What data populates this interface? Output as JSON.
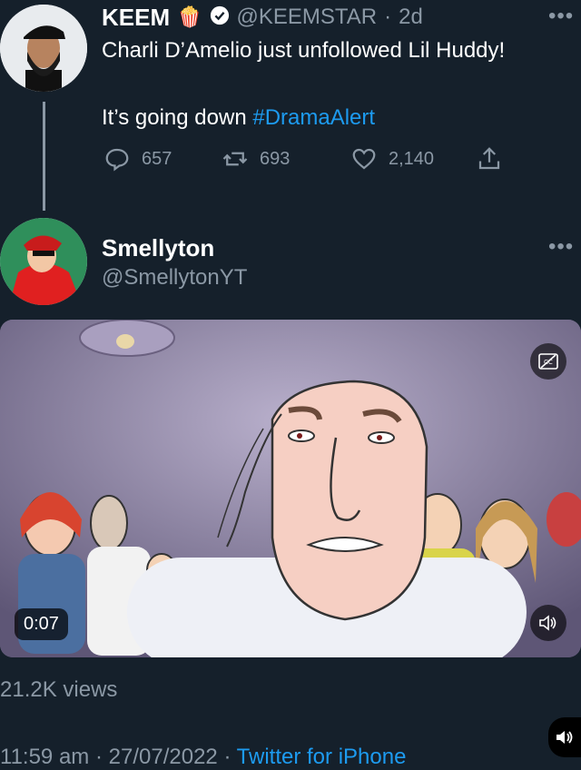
{
  "original_tweet": {
    "display_name": "KEEM",
    "emoji": "🍿",
    "handle": "@KEEMSTAR",
    "age": "2d",
    "text_line1": "Charli D’Amelio just unfollowed Lil Huddy!",
    "text_line2_prefix": "It’s going down ",
    "hashtag": "#DramaAlert",
    "replies": "657",
    "retweets": "693",
    "likes": "2,140"
  },
  "reply_tweet": {
    "display_name": "Smellyton",
    "handle": "@SmellytonYT"
  },
  "video": {
    "timestamp": "0:07"
  },
  "stats": {
    "views": "21.2K views"
  },
  "footer": {
    "time": "11:59 am",
    "date": "27/07/2022",
    "separator": "·",
    "source": "Twitter for iPhone"
  },
  "colors": {
    "background": "#15202b",
    "accent": "#1d9bf0",
    "muted": "#8b98a5"
  },
  "icons": [
    "verified-badge-icon",
    "popcorn-icon",
    "reply-icon",
    "retweet-icon",
    "like-icon",
    "share-icon",
    "captions-icon",
    "volume-icon",
    "more-icon"
  ]
}
